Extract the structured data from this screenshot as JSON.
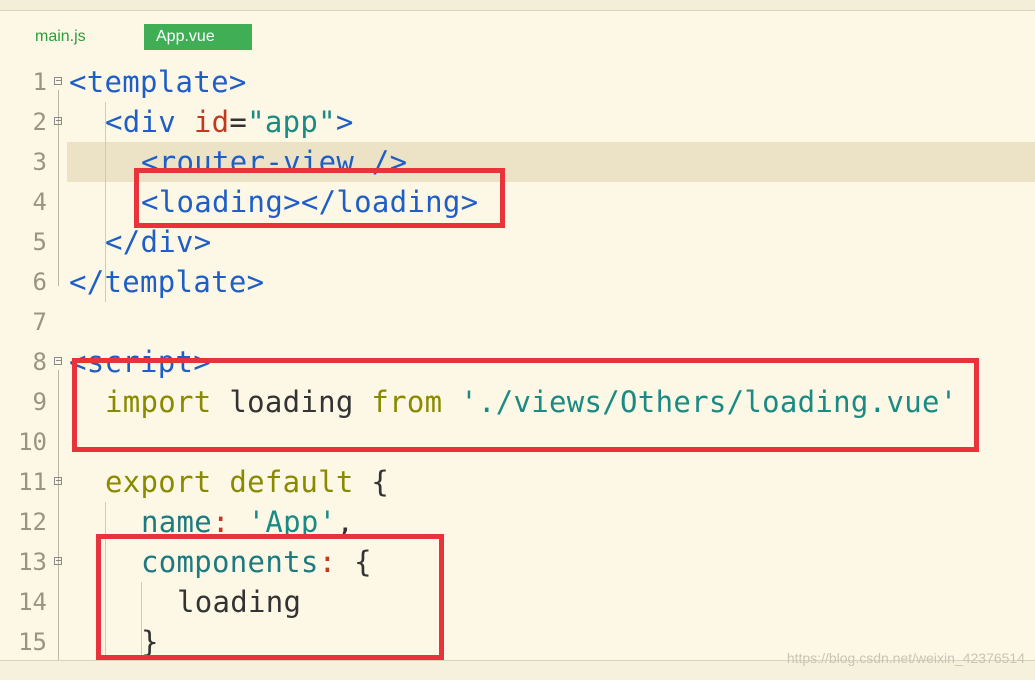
{
  "tabs": [
    {
      "label": "main.js",
      "active": false
    },
    {
      "label": "App.vue",
      "active": true
    }
  ],
  "line_numbers": [
    "1",
    "2",
    "3",
    "4",
    "5",
    "6",
    "7",
    "8",
    "9",
    "10",
    "11",
    "12",
    "13",
    "14",
    "15"
  ],
  "code": {
    "l1": {
      "a": "<template>"
    },
    "l2": {
      "a": "<div ",
      "b": "id",
      "c": "=",
      "d": "\"app\"",
      "e": ">"
    },
    "l3": {
      "a": "<router-view />"
    },
    "l4": {
      "a": "<loading></loading>"
    },
    "l5": {
      "a": "</div>"
    },
    "l6": {
      "a": "</template>"
    },
    "l8": {
      "a": "<script>"
    },
    "l9": {
      "a": "import",
      "b": " loading ",
      "c": "from",
      "d": " './views/Others/loading.vue'"
    },
    "l11": {
      "a": "export",
      "b": " default",
      "c": " {"
    },
    "l12": {
      "a": "name",
      "b": ":",
      "c": " 'App'",
      "d": ","
    },
    "l13": {
      "a": "components",
      "b": ":",
      "c": " {"
    },
    "l14": {
      "a": "loading"
    },
    "l15": {
      "a": "}"
    }
  },
  "watermark": "https://blog.csdn.net/weixin_42376514",
  "colors": {
    "highlight_box": "#e8333a",
    "active_tab": "#3fae55",
    "background": "#fdf8e5"
  }
}
